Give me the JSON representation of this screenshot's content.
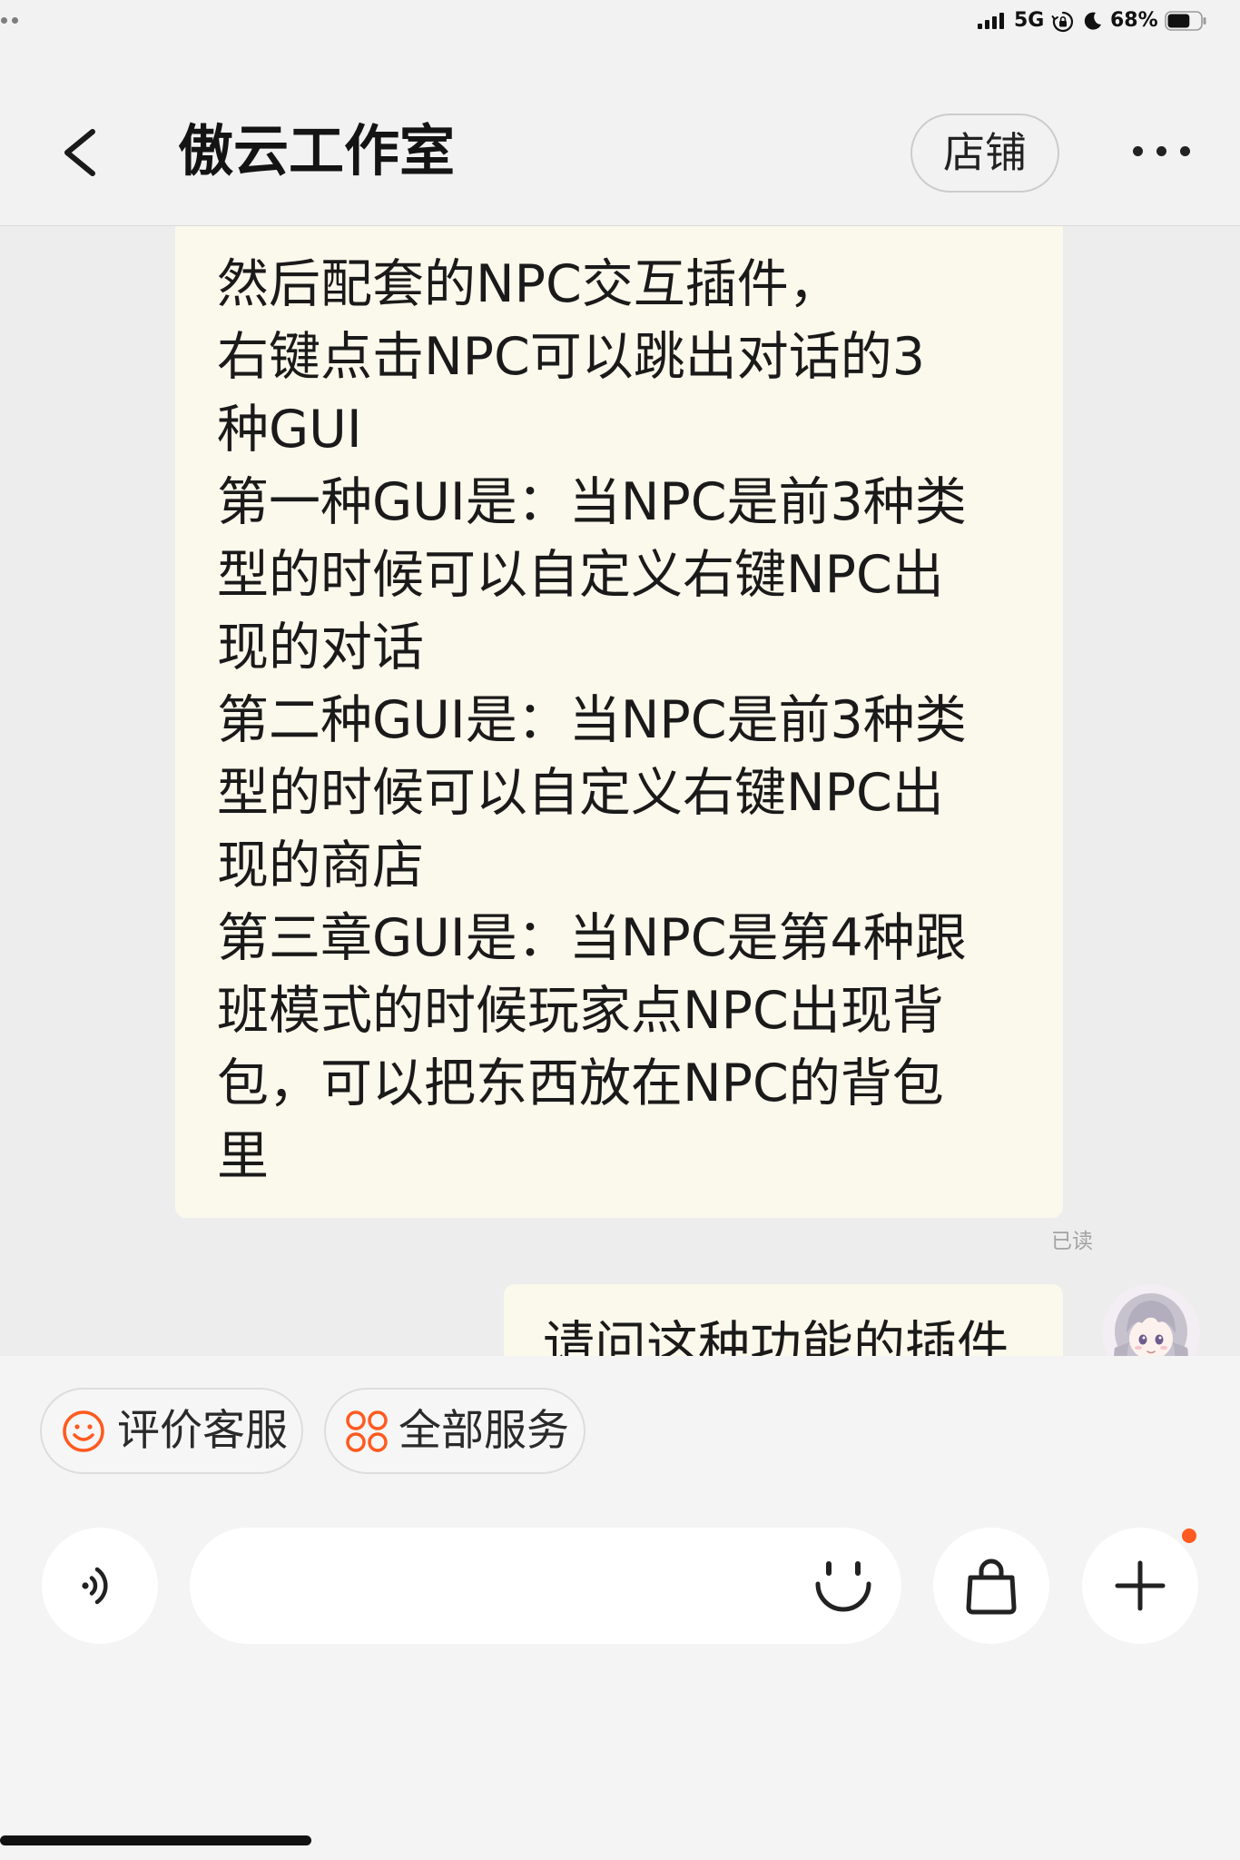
{
  "status_bar": {
    "network": "5G",
    "battery_text": "68%",
    "battery_level": 0.68,
    "icons": [
      "multitask-dots-icon",
      "signal-icon",
      "orientation-lock-icon",
      "moon-icon",
      "battery-icon"
    ]
  },
  "header": {
    "title": "傲云工作室",
    "store_button": "店铺",
    "icons": {
      "back": "chevron-left-icon",
      "more": "more-dots-icon"
    }
  },
  "chat": {
    "messages": [
      {
        "lines": [
          "然后配套的NPC交互插件，",
          "右键点击NPC可以跳出对话的3",
          "种GUI",
          "第一种GUI是：当NPC是前3种类",
          "型的时候可以自定义右键NPC出",
          "现的对话",
          "第二种GUI是：当NPC是前3种类",
          "型的时候可以自定义右键NPC出",
          "现的商店",
          "第三章GUI是：当NPC是第4种跟",
          "班模式的时候玩家点NPC出现背",
          "包，可以把东西放在NPC的背包",
          "里"
        ],
        "read_status": "已读"
      },
      {
        "lines": [
          "请问这种功能的插件"
        ]
      }
    ]
  },
  "quick_actions": [
    {
      "label": "评价客服",
      "icon": "smiley-icon"
    },
    {
      "label": "全部服务",
      "icon": "services-grid-icon"
    }
  ],
  "input_bar": {
    "icons": [
      "voice-icon",
      "emoji-icon",
      "shopping-bag-icon",
      "plus-icon"
    ],
    "plus_badge": true
  },
  "colors": {
    "accent": "#ff5a1f",
    "header_background": "#f2f2f2",
    "chat_background": "#ededed",
    "panel_background": "#f4f4f4",
    "bubble": "#fbf8ec",
    "text": "#1a1a1a"
  }
}
